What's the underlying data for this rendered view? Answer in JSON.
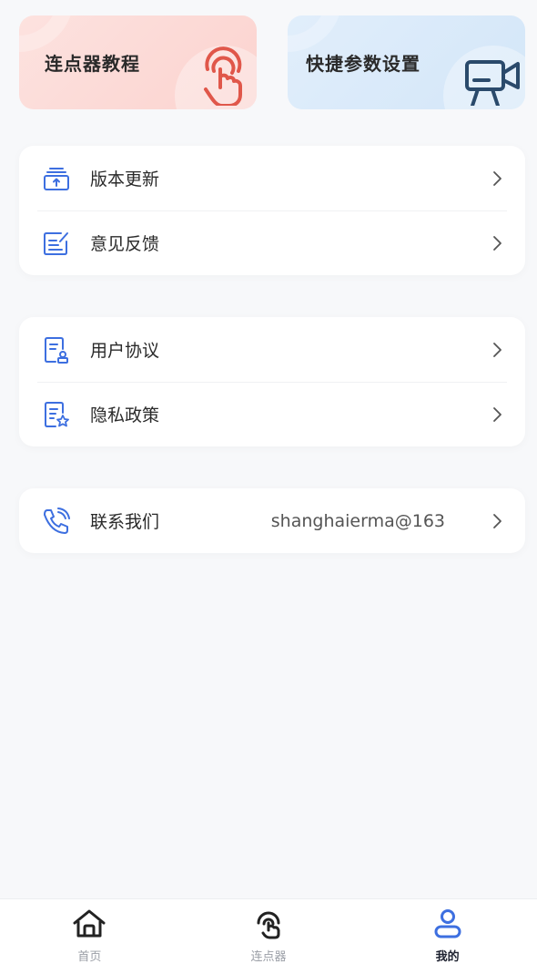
{
  "top_cards": [
    {
      "title": "连点器教程",
      "icon": "hand-tap-icon"
    },
    {
      "title": "快捷参数设置",
      "icon": "video-camera-icon"
    }
  ],
  "menu_group_1": [
    {
      "label": "版本更新",
      "icon": "version-update-icon"
    },
    {
      "label": "意见反馈",
      "icon": "feedback-edit-icon"
    }
  ],
  "menu_group_2": [
    {
      "label": "用户协议",
      "icon": "user-agreement-icon"
    },
    {
      "label": "隐私政策",
      "icon": "privacy-policy-icon"
    }
  ],
  "contact": {
    "label": "联系我们",
    "value": "shanghaierma@163",
    "icon": "phone-icon"
  },
  "tabbar": [
    {
      "label": "首页",
      "icon": "home-icon",
      "active": false
    },
    {
      "label": "连点器",
      "icon": "clicker-icon",
      "active": false
    },
    {
      "label": "我的",
      "icon": "profile-icon",
      "active": true
    }
  ],
  "colors": {
    "accent": "#3d6fe0",
    "pink_card": "#fbd3cf",
    "blue_card": "#d3e6f8",
    "icon_red": "#e0574a"
  }
}
